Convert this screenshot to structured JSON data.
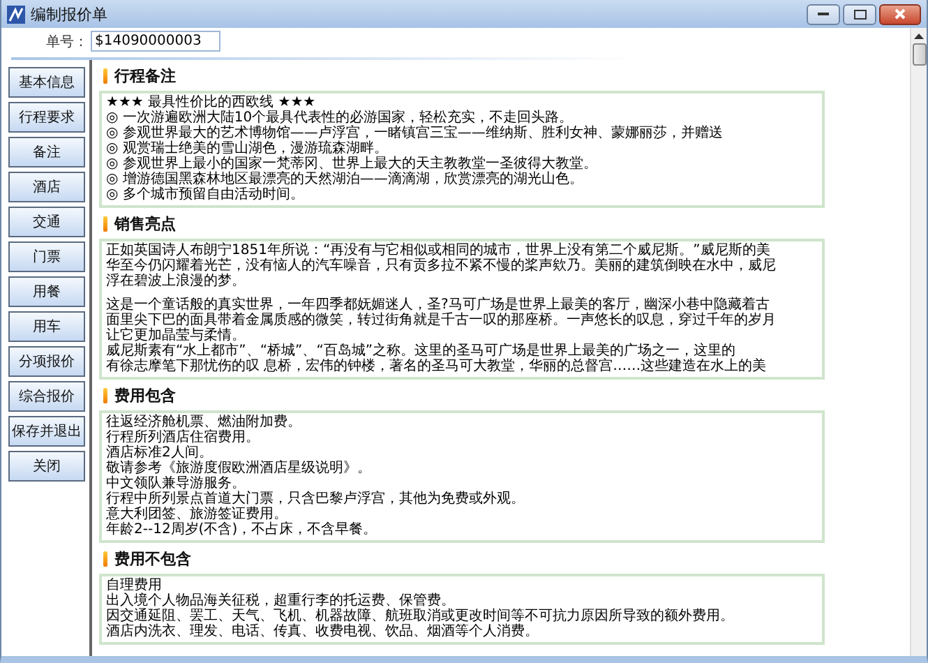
{
  "window": {
    "title": "编制报价单"
  },
  "order_number": {
    "label": "单号：",
    "value": "$14090000003"
  },
  "nav": [
    {
      "label": "基本信息"
    },
    {
      "label": "行程要求"
    },
    {
      "label": "备注"
    },
    {
      "label": "酒店"
    },
    {
      "label": "交通"
    },
    {
      "label": "门票"
    },
    {
      "label": "用餐"
    },
    {
      "label": "用车"
    },
    {
      "label": "分项报价"
    },
    {
      "label": "综合报价"
    },
    {
      "label": "保存并退出"
    },
    {
      "label": "关闭"
    }
  ],
  "sections": [
    {
      "title": "行程备注",
      "paragraphs": [
        [
          "★★★ 最具性价比的西欧线 ★★★",
          "◎ 一次游遍欧洲大陆10个最具代表性的必游国家，轻松充实，不走回头路。",
          "◎ 参观世界最大的艺术博物馆——卢浮宫，一睹镇宫三宝——维纳斯、胜利女神、蒙娜丽莎，并赠送",
          "◎ 观赏瑞士绝美的雪山湖色，漫游琉森湖畔。",
          "◎ 参观世界上最小的国家一梵蒂冈、世界上最大的天主教教堂一圣彼得大教堂。",
          "◎ 增游德国黑森林地区最漂亮的天然湖泊——滴滴湖，欣赏漂亮的湖光山色。",
          "◎ 多个城市预留自由活动时间。"
        ]
      ]
    },
    {
      "title": "销售亮点",
      "paragraphs": [
        [
          "正如英国诗人布朗宁1851年所说：“再没有与它相似或相同的城市，世界上没有第二个威尼斯。”威尼斯的美",
          "华至今仍闪耀着光芒，没有恼人的汽车噪音，只有贡多拉不紧不慢的桨声欸乃。美丽的建筑倒映在水中，威尼",
          "浮在碧波上浪漫的梦。"
        ],
        [
          "这是一个童话般的真实世界，一年四季都妩媚迷人，圣?马可广场是世界上最美的客厅，幽深小巷中隐藏着古",
          "面里尖下巴的面具带着金属质感的微笑，转过街角就是千古一叹的那座桥。一声悠长的叹息，穿过千年的岁月",
          "让它更加晶莹与柔情。",
          "威尼斯素有“水上都市”、“桥城”、“百岛城”之称。这里的圣马可广场是世界上最美的广场之一，这里的",
          "有徐志摩笔下那忧伤的叹 息桥，宏伟的钟楼，著名的圣马可大教堂，华丽的总督宫……这些建造在水上的美"
        ]
      ]
    },
    {
      "title": "费用包含",
      "paragraphs": [
        [
          "往返经济舱机票、燃油附加费。",
          "行程所列酒店住宿费用。",
          "酒店标准2人间。",
          "敬请参考《旅游度假欧洲酒店星级说明》。",
          "中文领队兼导游服务。",
          "行程中所列景点首道大门票，只含巴黎卢浮宫，其他为免费或外观。",
          "意大利团签、旅游签证费用。",
          "年龄2--12周岁(不含)，不占床，不含早餐。"
        ]
      ]
    },
    {
      "title": "费用不包含",
      "paragraphs": [
        [
          "自理费用",
          "出入境个人物品海关征税，超重行李的托运费、保管费。",
          "因交通延阻、罢工、天气、飞机、机器故障、航班取消或更改时间等不可抗力原因所导致的额外费用。",
          "酒店内洗衣、理发、电话、传真、收费电视、饮品、烟酒等个人消费。"
        ]
      ]
    }
  ]
}
